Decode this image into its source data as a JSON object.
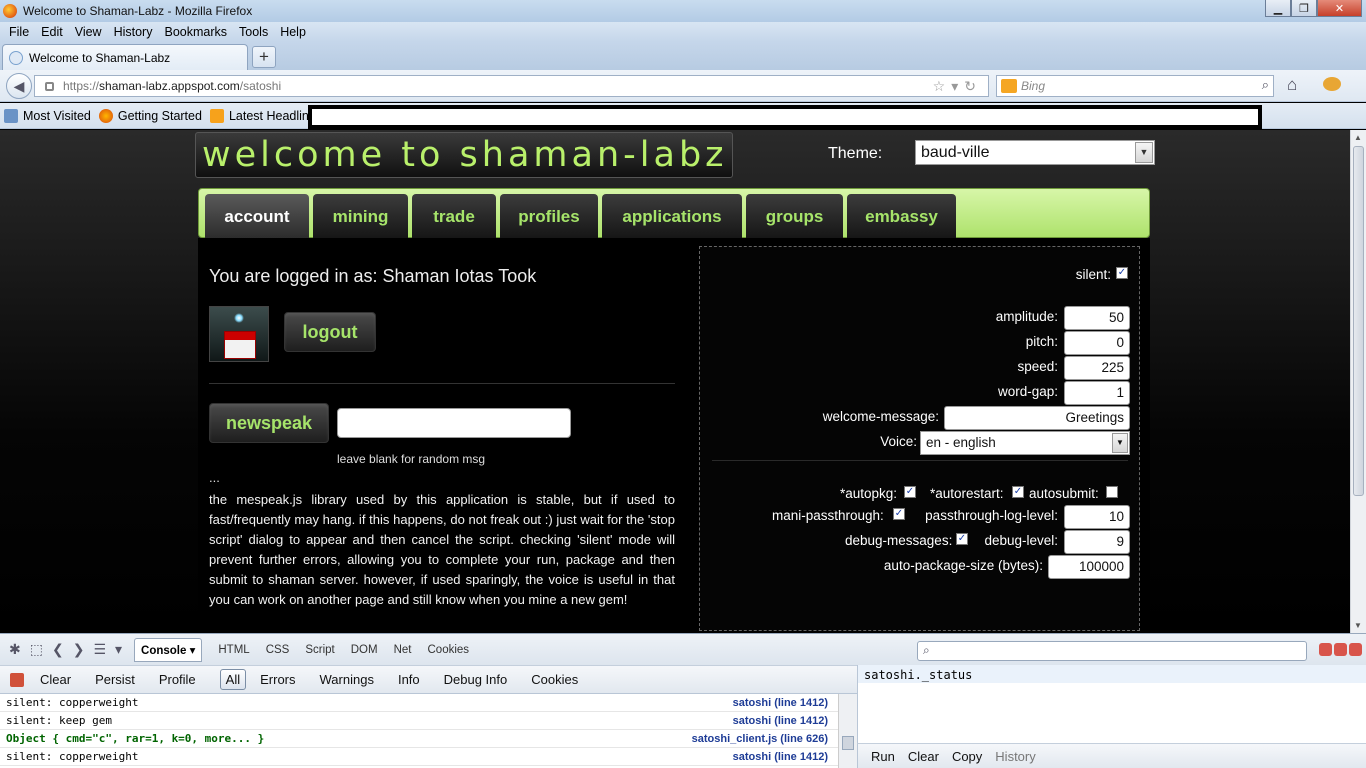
{
  "window": {
    "title": "Welcome to Shaman-Labz - Mozilla Firefox"
  },
  "menu": [
    "File",
    "Edit",
    "View",
    "History",
    "Bookmarks",
    "Tools",
    "Help"
  ],
  "tab": {
    "label": "Welcome to Shaman-Labz",
    "new_tab": "+"
  },
  "address": {
    "scheme": "https://",
    "host": "shaman-labz.appspot.com",
    "path": "/satoshi"
  },
  "search": {
    "placeholder": "Bing"
  },
  "bookmarks": [
    "Most Visited",
    "Getting Started",
    "Latest Headlines"
  ],
  "page": {
    "site_title": "welcome to shaman-labz",
    "theme_label": "Theme:",
    "theme_value": "baud-ville",
    "nav_tabs": [
      "account",
      "mining",
      "trade",
      "profiles",
      "applications",
      "groups",
      "embassy"
    ],
    "logged_in_text": "You are logged in as: Shaman Iotas Took",
    "logout_label": "logout",
    "newspeak_label": "newspeak",
    "newspeak_hint": "leave blank for random msg",
    "ellipsis": "...",
    "info_text": "the mespeak.js library used by this application is stable, but if used to fast/frequently may hang. if this happens, do not freak out :) just wait for the 'stop script' dialog to appear and then cancel the script. checking 'silent' mode will prevent further errors, allowing you to complete your run, package and then submit to shaman server. however, if used sparingly, the voice is useful in that you can work on another page and still know when you mine a new gem!",
    "settings": {
      "silent_label": "silent:",
      "silent_checked": true,
      "amplitude_label": "amplitude:",
      "amplitude": "50",
      "pitch_label": "pitch:",
      "pitch": "0",
      "speed_label": "speed:",
      "speed": "225",
      "word_gap_label": "word-gap:",
      "word_gap": "1",
      "welcome_label": "welcome-message:",
      "welcome": "Greetings",
      "voice_label": "Voice:",
      "voice": "en - english",
      "autopkg_label": "*autopkg:",
      "autopkg_checked": true,
      "autorestart_label": "*autorestart:",
      "autorestart_checked": true,
      "autosubmit_label": "autosubmit:",
      "autosubmit_checked": false,
      "mani_label": "mani-passthrough:",
      "mani_checked": true,
      "ptlog_label": "passthrough-log-level:",
      "ptlog": "10",
      "debugmsg_label": "debug-messages:",
      "debugmsg_checked": true,
      "debuglevel_label": "debug-level:",
      "debuglevel": "9",
      "autopkgsize_label": "auto-package-size (bytes):",
      "autopkgsize": "100000"
    }
  },
  "firebug": {
    "panels": [
      "Console",
      "HTML",
      "CSS",
      "Script",
      "DOM",
      "Net",
      "Cookies"
    ],
    "filters": [
      "Clear",
      "Persist",
      "Profile",
      "All",
      "Errors",
      "Warnings",
      "Info",
      "Debug Info",
      "Cookies"
    ],
    "log": [
      {
        "text": "silent: copperweight",
        "source": "satoshi (line 1412)",
        "obj": false
      },
      {
        "text": "silent: keep gem",
        "source": "satoshi (line 1412)",
        "obj": false
      },
      {
        "text": "Object { cmd=\"c\",  rar=1,  k=0,  more... }",
        "source": "satoshi_client.js (line 626)",
        "obj": true
      },
      {
        "text": "silent: copperweight",
        "source": "satoshi (line 1412)",
        "obj": false
      }
    ],
    "command_text": "satoshi._status",
    "command_buttons": [
      "Run",
      "Clear",
      "Copy",
      "History"
    ]
  }
}
